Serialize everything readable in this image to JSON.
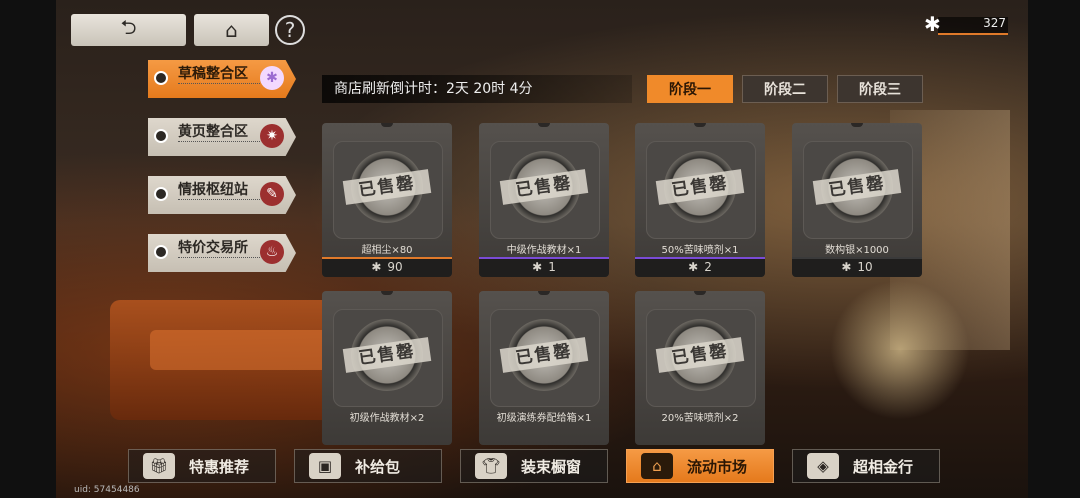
{
  "header": {
    "back_icon": "back-arrow-icon",
    "home_icon": "home-icon",
    "help_label": "?",
    "currency": {
      "icon": "snowflake-icon",
      "amount": "327"
    }
  },
  "sidebar": {
    "items": [
      {
        "label": "草稿整合区",
        "icon": "snowflake-icon",
        "active": true
      },
      {
        "label": "黄页整合区",
        "icon": "star-icon",
        "active": false
      },
      {
        "label": "情报枢纽站",
        "icon": "note-icon",
        "active": false
      },
      {
        "label": "特价交易所",
        "icon": "pot-icon",
        "active": false
      }
    ]
  },
  "shop": {
    "countdown": "商店刷新倒计时：2天 20时 4分",
    "stages": [
      {
        "label": "阶段一",
        "active": true
      },
      {
        "label": "阶段二",
        "active": false
      },
      {
        "label": "阶段三",
        "active": false
      }
    ],
    "sold_label": "已售罄",
    "currency_icon": "✱",
    "items": [
      {
        "name": "超相尘×80",
        "price": "90",
        "bar_color": "#e07a2a"
      },
      {
        "name": "中级作战教材×1",
        "price": "1",
        "bar_color": "#7a4bd6"
      },
      {
        "name": "50%苦味喷剂×1",
        "price": "2",
        "bar_color": "#7a4bd6"
      },
      {
        "name": "数构银×1000",
        "price": "10",
        "bar_color": "#3a3a3a"
      },
      {
        "name": "初级作战教材×2",
        "price": "",
        "bar_color": "#3a3a3a"
      },
      {
        "name": "初级演练券配给箱×1",
        "price": "",
        "bar_color": "#3a3a3a"
      },
      {
        "name": "20%苦味喷剂×2",
        "price": "",
        "bar_color": "#3a3a3a"
      }
    ]
  },
  "bottom_nav": {
    "items": [
      {
        "label": "特惠推荐",
        "icon": "gift-icon",
        "active": false
      },
      {
        "label": "补给包",
        "icon": "bag-icon",
        "active": false
      },
      {
        "label": "装束橱窗",
        "icon": "shirt-icon",
        "active": false
      },
      {
        "label": "流动市场",
        "icon": "store-icon",
        "active": true
      },
      {
        "label": "超相金行",
        "icon": "cube-icon",
        "active": false
      }
    ]
  },
  "footer": {
    "uid": "uid: 57454486"
  }
}
